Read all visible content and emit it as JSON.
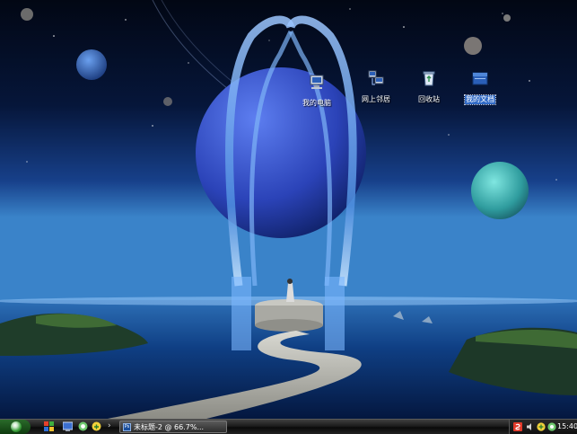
{
  "desktop": {
    "icons": [
      {
        "label": "我的电脑",
        "icon": "my-computer-icon"
      },
      {
        "label": "网上邻居",
        "icon": "network-places-icon"
      },
      {
        "label": "回收站",
        "icon": "recycle-bin-icon"
      },
      {
        "label": "我的文档",
        "icon": "my-documents-icon"
      }
    ]
  },
  "taskbar": {
    "start_icon": "start-orb-icon",
    "quick_launch_arrow": "›",
    "task": {
      "label": "未标题-2 @ 66.7%...",
      "icon": "photoshop-icon",
      "icon_text": "Ps"
    },
    "clock": "15:40"
  },
  "colors": {
    "taskbar": "#1c1c1c",
    "selection": "#316ac5",
    "start": "#2f8f2f"
  }
}
